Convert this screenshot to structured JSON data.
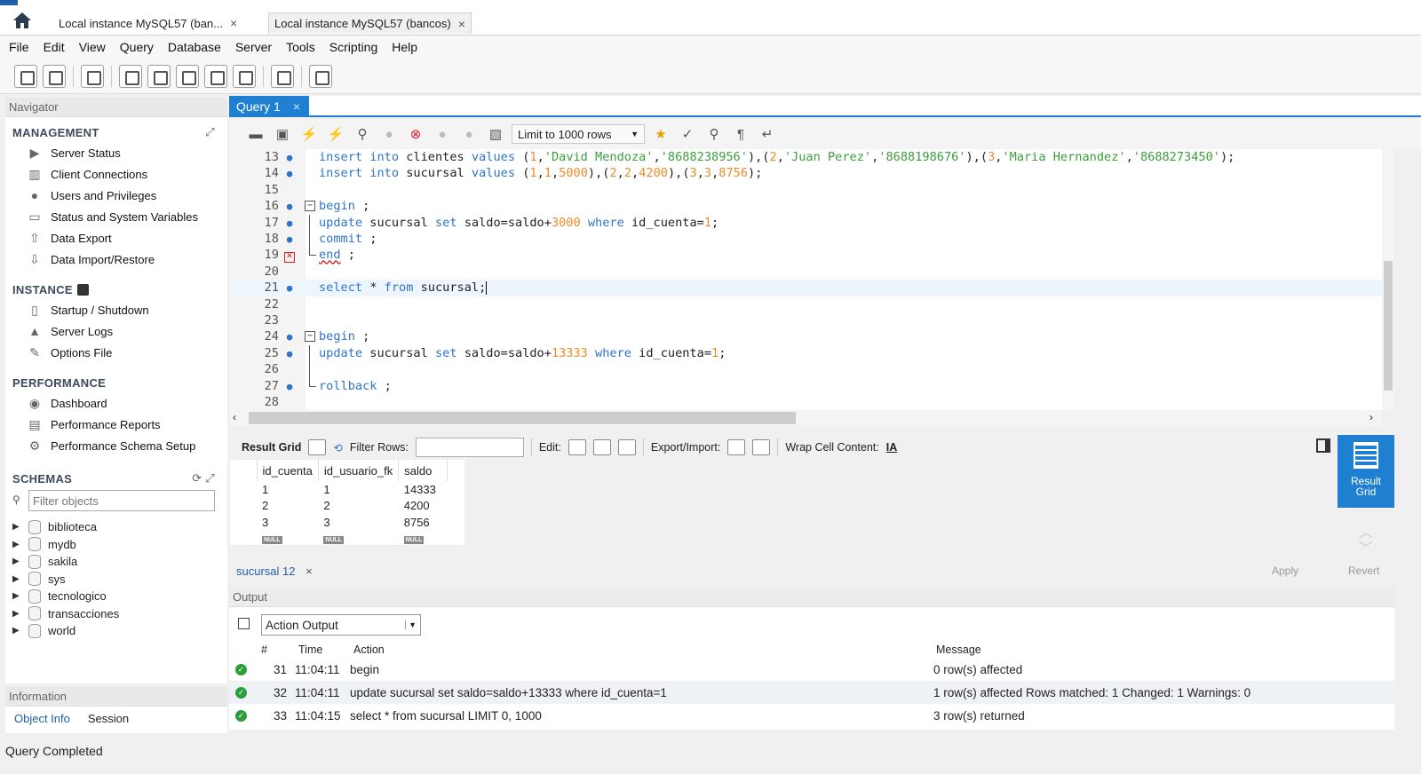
{
  "tabs": [
    {
      "label": "Local instance MySQL57 (ban...",
      "close": "×"
    },
    {
      "label": "Local instance MySQL57 (bancos)",
      "close": "×"
    }
  ],
  "menu": [
    "File",
    "Edit",
    "View",
    "Query",
    "Database",
    "Server",
    "Tools",
    "Scripting",
    "Help"
  ],
  "navigator": {
    "title": "Navigator",
    "management": {
      "title": "MANAGEMENT",
      "items": [
        "Server Status",
        "Client Connections",
        "Users and Privileges",
        "Status and System Variables",
        "Data Export",
        "Data Import/Restore"
      ]
    },
    "instance": {
      "title": "INSTANCE",
      "items": [
        "Startup / Shutdown",
        "Server Logs",
        "Options File"
      ]
    },
    "performance": {
      "title": "PERFORMANCE",
      "items": [
        "Dashboard",
        "Performance Reports",
        "Performance Schema Setup"
      ]
    },
    "schemas": {
      "title": "SCHEMAS",
      "filter_placeholder": "Filter objects",
      "items": [
        "biblioteca",
        "mydb",
        "sakila",
        "sys",
        "tecnologico",
        "transacciones",
        "world"
      ]
    }
  },
  "information": {
    "title": "Information",
    "tabs": [
      "Object Info",
      "Session"
    ]
  },
  "query_tab": {
    "label": "Query 1",
    "close": "×"
  },
  "editor_toolbar": {
    "limit": "Limit to 1000 rows"
  },
  "editor": {
    "lines": [
      {
        "n": "13",
        "marker": "dot"
      },
      {
        "n": "14",
        "marker": "dot"
      },
      {
        "n": "15",
        "marker": ""
      },
      {
        "n": "16",
        "marker": "dot"
      },
      {
        "n": "17",
        "marker": "dot"
      },
      {
        "n": "18",
        "marker": "dot"
      },
      {
        "n": "19",
        "marker": "error"
      },
      {
        "n": "20",
        "marker": ""
      },
      {
        "n": "21",
        "marker": "dot"
      },
      {
        "n": "22",
        "marker": ""
      },
      {
        "n": "23",
        "marker": ""
      },
      {
        "n": "24",
        "marker": "dot"
      },
      {
        "n": "25",
        "marker": "dot"
      },
      {
        "n": "26",
        "marker": ""
      },
      {
        "n": "27",
        "marker": "dot"
      },
      {
        "n": "28",
        "marker": ""
      }
    ],
    "tokens": {
      "l13": [
        "insert",
        "into",
        "clientes",
        "values",
        "(",
        "1",
        ",",
        "'David Mendoza'",
        ",",
        "'8688238956'",
        "),(",
        "2",
        ",",
        "'Juan Perez'",
        ",",
        "'8688198676'",
        "),(",
        "3",
        ",",
        "'Maria Hernandez'",
        ",",
        "'8688273450'",
        ");"
      ],
      "l14": [
        "insert",
        "into",
        "sucursal",
        "values",
        "(",
        "1",
        ",",
        "1",
        ",",
        "5000",
        "),(",
        "2",
        ",",
        "2",
        ",",
        "4200",
        "),(",
        "3",
        ",",
        "3",
        ",",
        "8756",
        ");"
      ],
      "l16": [
        "begin",
        ";"
      ],
      "l17": [
        "update",
        "sucursal",
        "set",
        "saldo=saldo+",
        "3000",
        "where",
        "id_cuenta=",
        "1",
        ";"
      ],
      "l18": [
        "commit",
        ";"
      ],
      "l19": [
        "end",
        ";"
      ],
      "l21": [
        "select",
        "*",
        "from",
        "sucursal;"
      ],
      "l24": [
        "begin",
        ";"
      ],
      "l25": [
        "update",
        "sucursal",
        "set",
        "saldo=saldo+",
        "13333",
        "where",
        "id_cuenta=",
        "1",
        ";"
      ],
      "l27": [
        "rollback",
        ";"
      ]
    }
  },
  "result_toolbar": {
    "result_grid": "Result Grid",
    "filter_rows": "Filter Rows:",
    "edit": "Edit:",
    "export_import": "Export/Import:",
    "wrap": "Wrap Cell Content:"
  },
  "result": {
    "columns": [
      "id_cuenta",
      "id_usuario_fk",
      "saldo"
    ],
    "rows": [
      [
        "1",
        "1",
        "14333"
      ],
      [
        "2",
        "2",
        "4200"
      ],
      [
        "3",
        "3",
        "8756"
      ]
    ],
    "null_label": "NULL"
  },
  "result_side": {
    "label1": "Result",
    "label2": "Grid",
    "apply": "Apply",
    "revert": "Revert"
  },
  "result_tab": {
    "label": "sucursal 12",
    "close": "×"
  },
  "output": {
    "title": "Output",
    "select": "Action Output",
    "columns": [
      "#",
      "Time",
      "Action",
      "Message"
    ],
    "rows": [
      {
        "num": "31",
        "time": "11:04:11",
        "action": "begin",
        "message": "0 row(s) affected"
      },
      {
        "num": "32",
        "time": "11:04:11",
        "action": "update sucursal set saldo=saldo+13333 where id_cuenta=1",
        "message": "1 row(s) affected Rows matched: 1  Changed: 1  Warnings: 0"
      },
      {
        "num": "33",
        "time": "11:04:15",
        "action": "select * from sucursal LIMIT 0, 1000",
        "message": "3 row(s) returned"
      }
    ]
  },
  "status": "Query Completed"
}
